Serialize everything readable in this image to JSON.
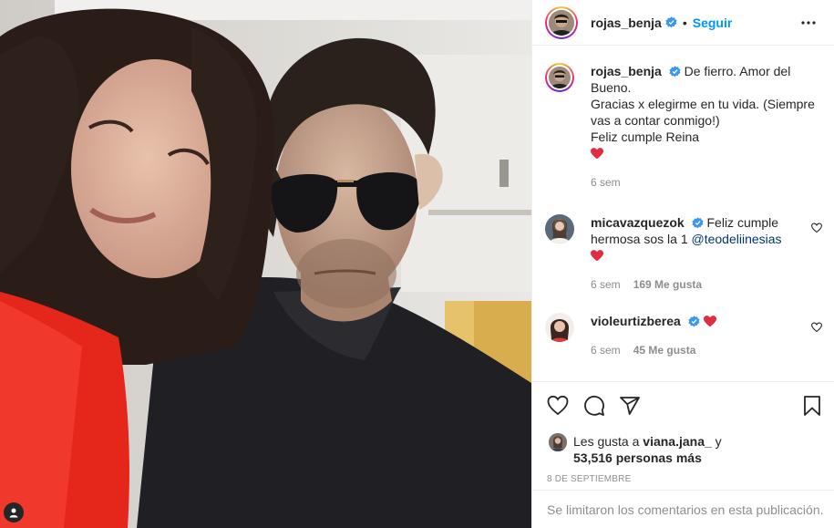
{
  "post": {
    "image_alt": "",
    "username": "rojas_benja",
    "follow_label": "Seguir",
    "separator": "•"
  },
  "caption": {
    "username": "rojas_benja",
    "line1": "De fierro. Amor del Bueno.",
    "line2": "Gracias x elegirme en tu vida. (Siempre vas a contar conmigo!)",
    "line3": "Feliz cumple Reina",
    "time": "6 sem"
  },
  "comments": [
    {
      "username": "micavazquezok",
      "text": "Feliz cumple hermosa sos la 1",
      "mention": "@teodeliinesias",
      "time": "6 sem",
      "likes": "169 Me gusta"
    },
    {
      "username": "violeurtizberea",
      "text": "",
      "time": "6 sem",
      "likes": "45 Me gusta"
    }
  ],
  "likes": {
    "prefix": "Les gusta a",
    "user": "viana.jana_",
    "connector": "y",
    "count": "53,516 personas más"
  },
  "date": "8 DE SEPTIEMBRE",
  "comments_disabled": "Se limitaron los comentarios en esta publicación.",
  "colors": {
    "link_blue": "#0095f6",
    "heart_red": "#ed4956",
    "muted": "#8e8e8e",
    "text": "#262626",
    "verified": "#3897f0"
  },
  "icons": [
    "verified-icon",
    "more-icon",
    "heart-icon",
    "comment-icon",
    "share-icon",
    "save-icon",
    "user-tag-icon"
  ]
}
